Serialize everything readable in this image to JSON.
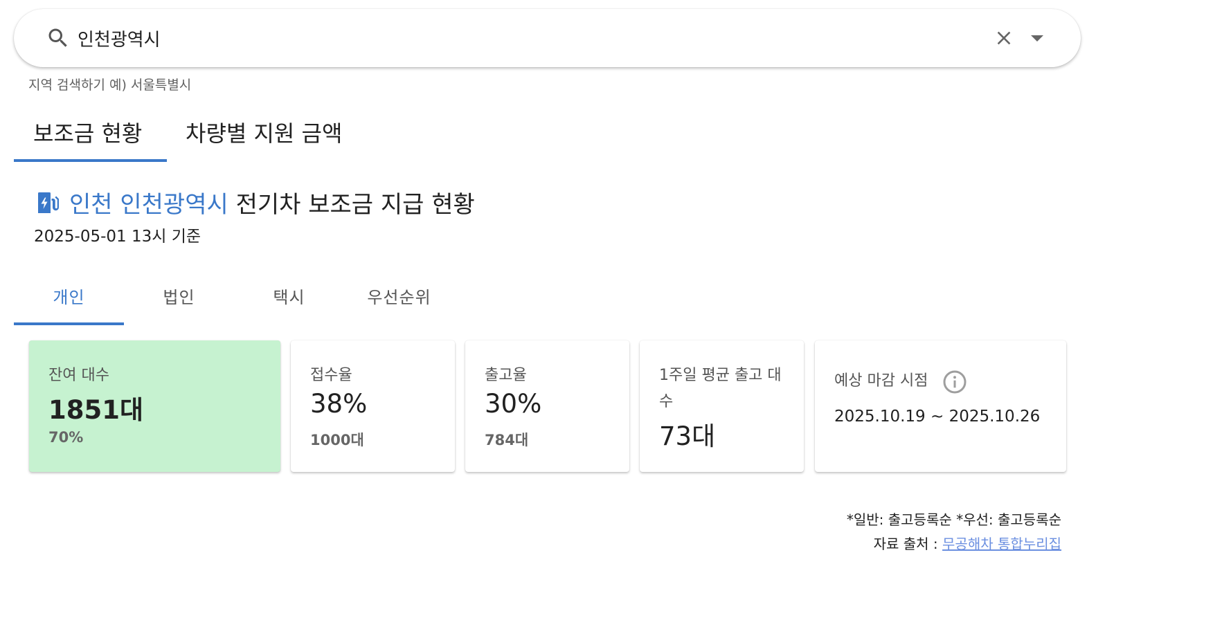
{
  "search": {
    "value": "인천광역시",
    "hint": "지역 검색하기 예) 서울특별시",
    "icon": "search-icon"
  },
  "main_tabs": [
    {
      "label": "보조금 현황",
      "active": true
    },
    {
      "label": "차량별 지원 금액",
      "active": false
    }
  ],
  "title": {
    "region": "인천 인천광역시",
    "text": "전기차 보조금 지급 현황",
    "icon": "ev-charging-icon"
  },
  "as_of": "2025-05-01 13시 기준",
  "sub_tabs": [
    {
      "label": "개인",
      "active": true
    },
    {
      "label": "법인",
      "active": false
    },
    {
      "label": "택시",
      "active": false
    },
    {
      "label": "우선순위",
      "active": false
    }
  ],
  "cards": {
    "remaining": {
      "label": "잔여 대수",
      "value": "1851대",
      "sub": "70%"
    },
    "reception": {
      "label": "접수율",
      "value": "38%",
      "sub": "1000대"
    },
    "release": {
      "label": "출고율",
      "value": "30%",
      "sub": "784대"
    },
    "weekly_avg": {
      "label": "1주일 평균 출고 대수",
      "value": "73대"
    },
    "deadline": {
      "label": "예상 마감 시점",
      "value": "2025.10.19 ~ 2025.10.26"
    }
  },
  "footer": {
    "note": "*일반: 출고등록순 *우선: 출고등록순",
    "source_label": "자료 출처 : ",
    "source_link": "무공해차 통합누리집"
  },
  "colors": {
    "accent": "#3a78c9",
    "highlight_card": "#c6f2d0",
    "link": "#6b8fe0"
  }
}
